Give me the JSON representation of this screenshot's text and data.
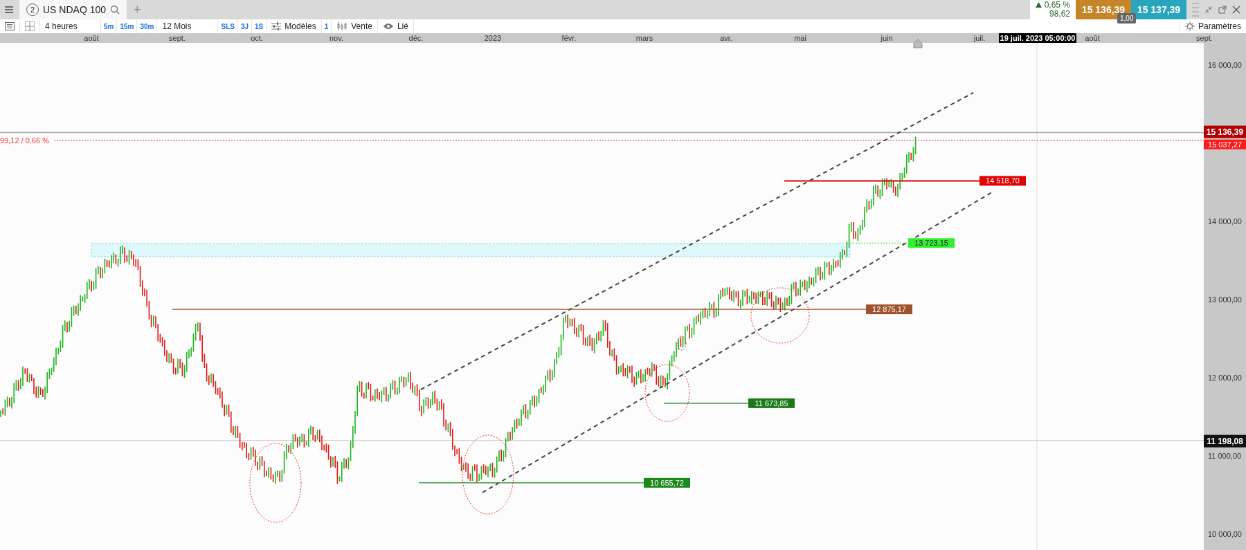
{
  "tab_bar": {
    "tabs": [
      {
        "number": "2",
        "label": "US NDAQ 100",
        "selected": true
      }
    ],
    "add_glyph": "+"
  },
  "quote": {
    "change": "0,65 %",
    "change_value": "98,62",
    "sell_price": "15 136,39",
    "buy_price": "15 137,39",
    "quantity": "1,00"
  },
  "toolbar": {
    "interval": "4 heures",
    "interval_shortcuts": [
      "5m",
      "15m",
      "30m"
    ],
    "period": "12 Mois",
    "period_shortcuts": [
      "SLS",
      "3J",
      "1S"
    ],
    "templates": "Modèles",
    "count": "1",
    "chart_type": "Vente",
    "linked": "Lié",
    "settings": "Paramètres"
  },
  "time_axis": {
    "labels": [
      "août",
      "sept.",
      "oct.",
      "nov.",
      "déc.",
      "2023",
      "févr.",
      "mars",
      "avr.",
      "mai",
      "juin",
      "juil.",
      "août",
      "sept."
    ],
    "cursor_label": "19 juil. 2023 05:00:00"
  },
  "chart": {
    "left_label": "99,12 / 0,66 %",
    "price_axis": {
      "ticks": [
        "16 000,00",
        "14 000,00",
        "13 000,00",
        "12 000,00",
        "11 000,00",
        "10 000,00"
      ]
    },
    "markers": [
      {
        "text": "15 136,39",
        "kind": "last"
      },
      {
        "text": "15 037,27",
        "kind": "reference"
      },
      {
        "text": "11 198,08",
        "kind": "crosshair"
      }
    ],
    "levels": [
      {
        "text": "14 518,70",
        "color": "#e00000"
      },
      {
        "text": "13 723,15",
        "color": "#33ee33"
      },
      {
        "text": "12 875,17",
        "color": "#a0522d"
      },
      {
        "text": "11 673,85",
        "color": "#1a7a1a"
      },
      {
        "text": "10 655,72",
        "color": "#1a8a1a"
      }
    ]
  }
}
